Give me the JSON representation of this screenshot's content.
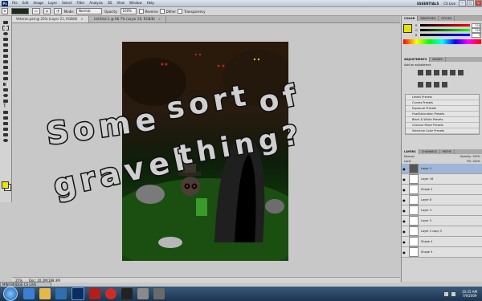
{
  "app": {
    "logo": "Ps",
    "menu": [
      "File",
      "Edit",
      "Image",
      "Layer",
      "Select",
      "Filter",
      "Analysis",
      "3D",
      "View",
      "Window",
      "Help"
    ],
    "workspace_label": "ESSENTIALS",
    "cs_live": "CS Live",
    "min": "–",
    "max": "□",
    "close": "×"
  },
  "options": {
    "mode_label": "Mode:",
    "mode_value": "Normal",
    "opacity_label": "Opacity:",
    "opacity_value": "100%",
    "reverse_label": "Reverse",
    "dither_label": "Dither",
    "transparency_label": "Transparency"
  },
  "tabs": [
    {
      "label": "Veteran.psd @ 25% (Layer 21, RGB/8)",
      "active": true
    },
    {
      "label": "Untitled-1 @ 66.7% (Layer 20, RGB/8)",
      "active": false
    }
  ],
  "canvas": {
    "overlay_words": [
      "Some",
      "sort",
      "of",
      "gravel",
      "thing?"
    ],
    "colors": {
      "eyes": "#c0221a",
      "moss": "#2f7b1f",
      "stroke": "#111111",
      "letter": "#cfcfcf"
    }
  },
  "status": {
    "zoom": "25%",
    "doc": "Doc: 20.2M/188.3M"
  },
  "minibridge": "MINI BRIDGE  CS LIVE",
  "panels": {
    "color_tabs": [
      "COLOR",
      "SWATCHES",
      "STYLES"
    ],
    "rgb": [
      {
        "ch": "R",
        "value": "228"
      },
      {
        "ch": "G",
        "value": "228"
      },
      {
        "ch": "B",
        "value": "0"
      }
    ],
    "adjust_tabs": [
      "ADJUSTMENTS",
      "MASKS"
    ],
    "adjust_title": "Add an adjustment",
    "presets": [
      "Levels Presets",
      "Curves Presets",
      "Exposure Presets",
      "Hue/Saturation Presets",
      "Black & White Presets",
      "Channel Mixer Presets",
      "Selective Color Presets"
    ],
    "layer_tabs": [
      "LAYERS",
      "CHANNELS",
      "PATHS"
    ],
    "blend_mode": "Normal",
    "layer_opacity": "Opacity: 100%",
    "lock_label": "Lock:",
    "fill": "Fill: 100%",
    "layers": [
      "Layer 1",
      "Layer 16",
      "Shape 2",
      "Layer 8",
      "Layer 4",
      "Layer 5",
      "Layer 2 copy 3",
      "Shape 4",
      "Shape 5"
    ]
  },
  "taskbar": {
    "time": "10:25 AM",
    "date": "7/9/2009",
    "icons": [
      "internet-explorer",
      "folder",
      "media-player",
      "photoshop",
      "acrobat",
      "paint",
      "winamp",
      "app",
      "app"
    ]
  }
}
